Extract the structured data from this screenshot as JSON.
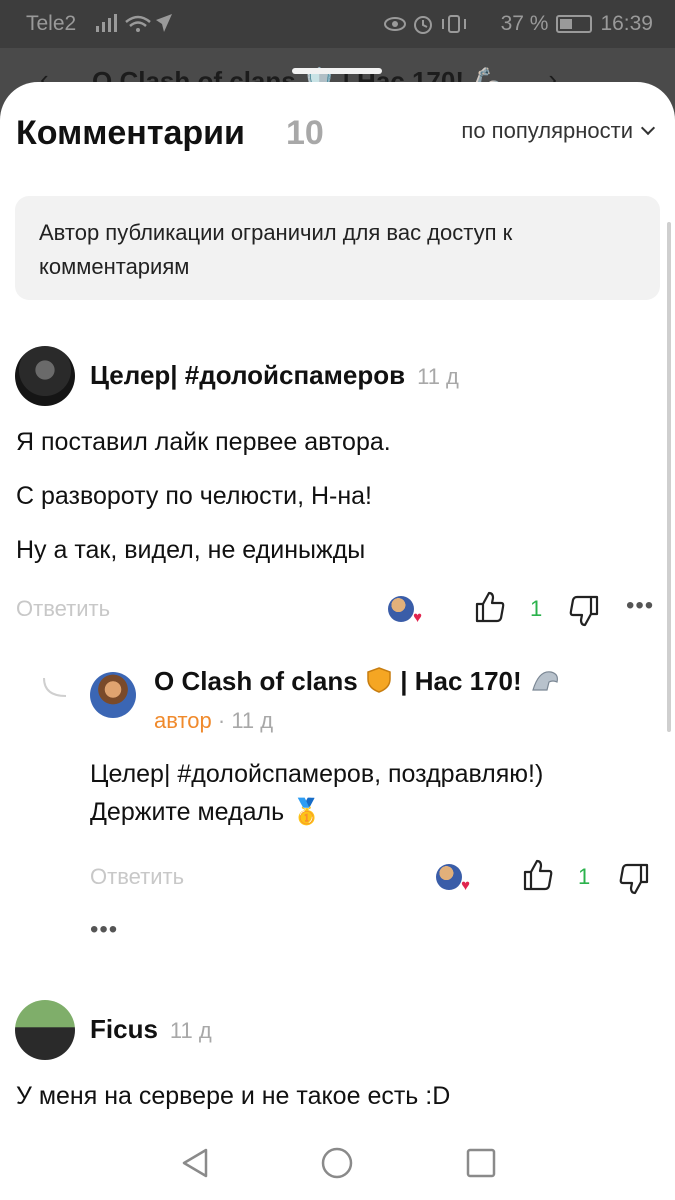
{
  "status_bar": {
    "carrier": "Tele2",
    "signal": "..ıll",
    "battery": "37 %",
    "time": "16:39"
  },
  "background_header": {
    "title": "О Clash of clans 🛡️ | Нас 170! 🦾"
  },
  "comments_panel": {
    "title": "Комментарии",
    "count": "10",
    "sort_label": "по популярности",
    "notice": "Автор публикации ограничил для вас доступ к комментариям",
    "reply_label": "Ответить",
    "comments": [
      {
        "author": "Целер| #долойспамеров",
        "time": "11 д",
        "lines": [
          "Я поставил лайк первее автора.",
          "С развороту по челюсти, Н-на!",
          "Ну а так, видел, не единыжды"
        ],
        "likes": "1",
        "reply": {
          "author": "О Clash of clans",
          "author_suffix": "| Нас 170!",
          "author_tag": "автор",
          "time": "11 д",
          "lines": [
            "Целер| #долойспамеров, поздравляю!)",
            "Держите медаль 🥇"
          ],
          "likes": "1"
        }
      },
      {
        "author": "Ficus",
        "time": "11 д",
        "lines": [
          "У меня на сервере и не такое есть :D"
        ]
      }
    ]
  },
  "colors": {
    "like_green": "#2bb24c",
    "author_orange": "#f08a2c",
    "muted_gray": "#a8a8a8"
  }
}
